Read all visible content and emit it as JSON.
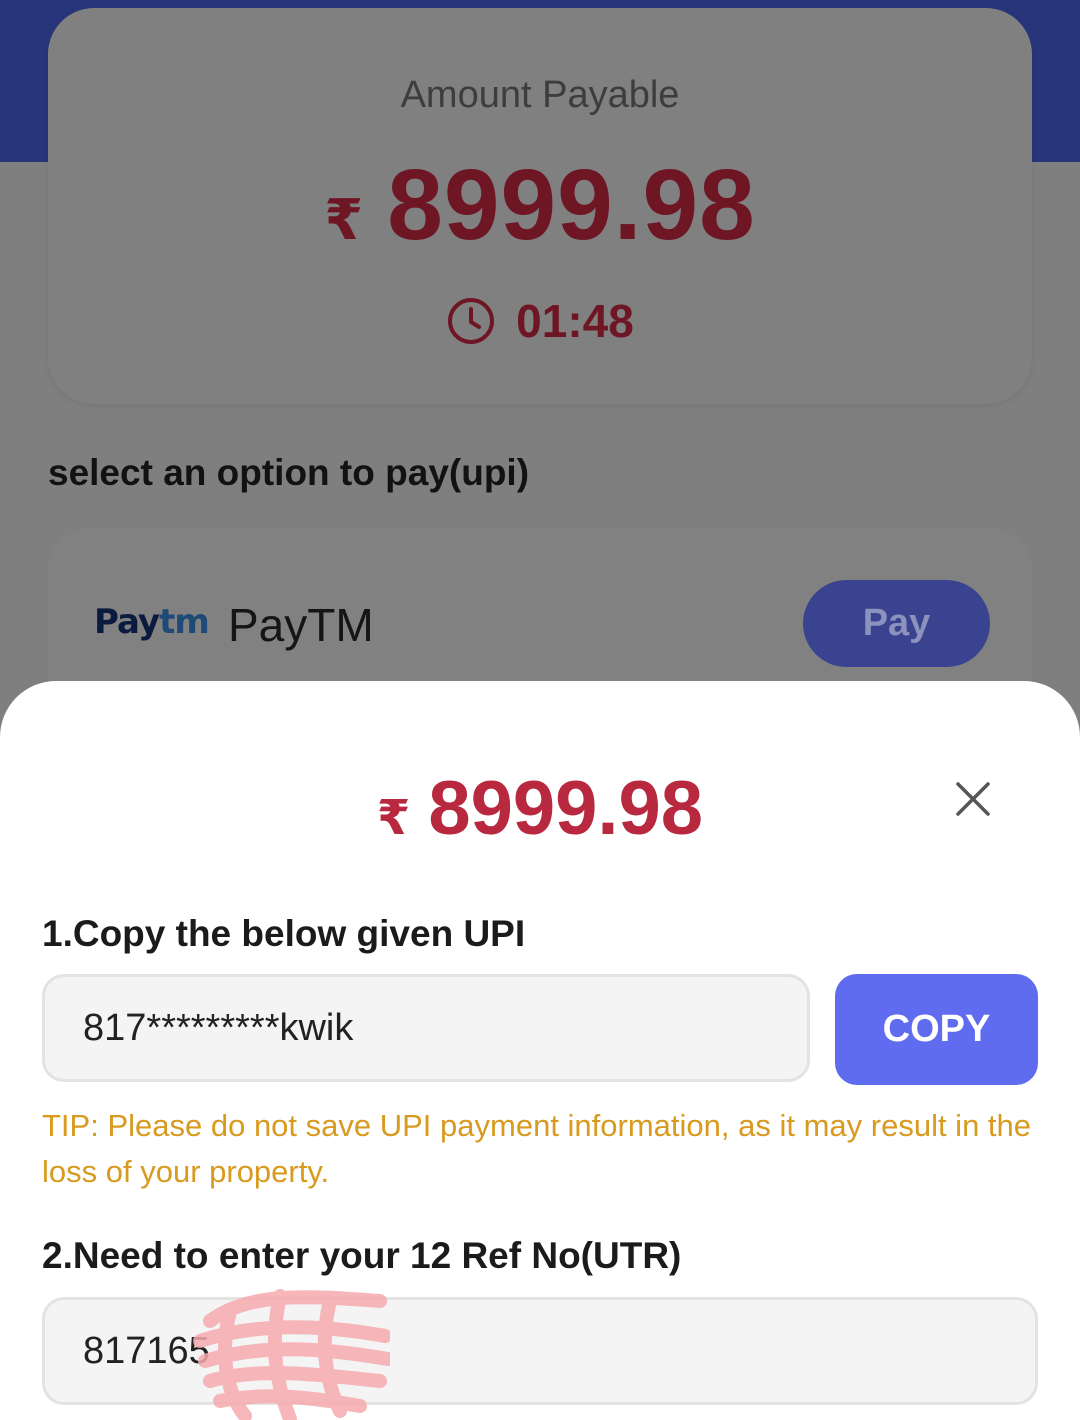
{
  "amount_card": {
    "label": "Amount Payable",
    "currency": "₹",
    "amount": "8999.98",
    "timer": "01:48"
  },
  "section_title": "select an option to pay(upi)",
  "payment_option": {
    "logo_part1": "Pay",
    "logo_part2": "tm",
    "name": "PayTM",
    "pay_label": "Pay"
  },
  "sheet": {
    "currency": "₹",
    "amount": "8999.98",
    "step1_title": "1.Copy the below given UPI",
    "upi_value": "817*********kwik",
    "copy_label": "COPY",
    "tip": "TIP: Please do not save UPI payment information, as it may result in the loss of your property.",
    "step2_title": "2.Need to enter your 12 Ref No(UTR)",
    "utr_value": "817165"
  },
  "icons": [
    "clock-icon",
    "close-icon",
    "paytm-logo"
  ],
  "colors": {
    "accent": "#5f6cf0",
    "amount_red": "#b8283e",
    "tip": "#d89a1f",
    "header": "#28357a"
  }
}
